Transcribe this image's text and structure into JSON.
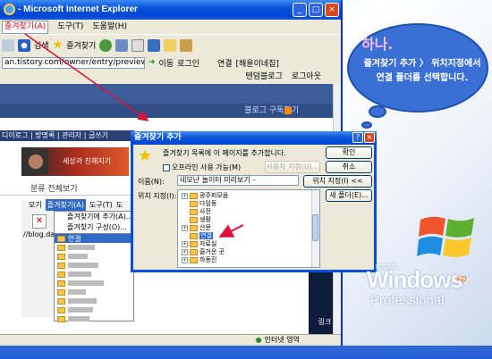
{
  "ie": {
    "title": "- Microsoft Internet Explorer",
    "menu": [
      "즐겨찾기(A)",
      "도구(T)",
      "도움말(H)"
    ],
    "toolbar": {
      "search": "검색",
      "favorites": "즐겨찾기"
    },
    "address": "an.tistory.com/owner/entry/preview/0",
    "go": "이동",
    "login": "로그인",
    "links_label": "연결",
    "links_item": "[해윤이네집]",
    "top_links": [
      "텐덤블로그",
      "로그아웃"
    ],
    "subscribe": "블로그 구독하기",
    "nav_text": "디이로그 | 방명록 | 관리자 | 글쓰기",
    "banner_text": "세상과 친해지기",
    "category": "분류 전체보기",
    "menu_strip": [
      "모기",
      "즐겨찾기(A)",
      "도구(T)",
      "도"
    ],
    "fav_dropdown": [
      "즐겨찾기에 추가(A)...",
      "즐겨찾기 구성(O)..."
    ],
    "url_fragment": "//blog.da",
    "links_folder": "연결",
    "status": "인터넷 영역",
    "dark_label": "링크"
  },
  "dialog": {
    "title": "즐겨찾기 추가",
    "message": "즐겨찾기 목록에 이 페이지를 추가합니다.",
    "offline": "오프라인 사용 가능(M)",
    "custom_btn": "사용자 지정(U)...",
    "ok": "확인",
    "cancel": "취소",
    "name_label": "이름(N):",
    "name_value": "네모난 놀이터 미리보기 -",
    "location_btn": "위치 지정(I) <<",
    "location_label": "위치 지정(I):",
    "new_folder": "새 폴더(E)...",
    "tree": [
      "광주피모음",
      "다임동",
      "사전",
      "생활",
      "산문",
      "연결",
      "자료실",
      "즐거운 곳",
      "하동진"
    ]
  },
  "callout": {
    "heading": "하나.",
    "line1": "즐겨찾기 추가 〉 위치지정에서",
    "line2": "연결 폴더를 선택합니다."
  },
  "winlogo": {
    "ms": "rosoft",
    "windows": "Windows",
    "xp": "xp",
    "edition": "Professional"
  },
  "colors": {
    "accent": "#0a53d8",
    "arrow": "#e0103c",
    "selection": "#316ac5"
  }
}
